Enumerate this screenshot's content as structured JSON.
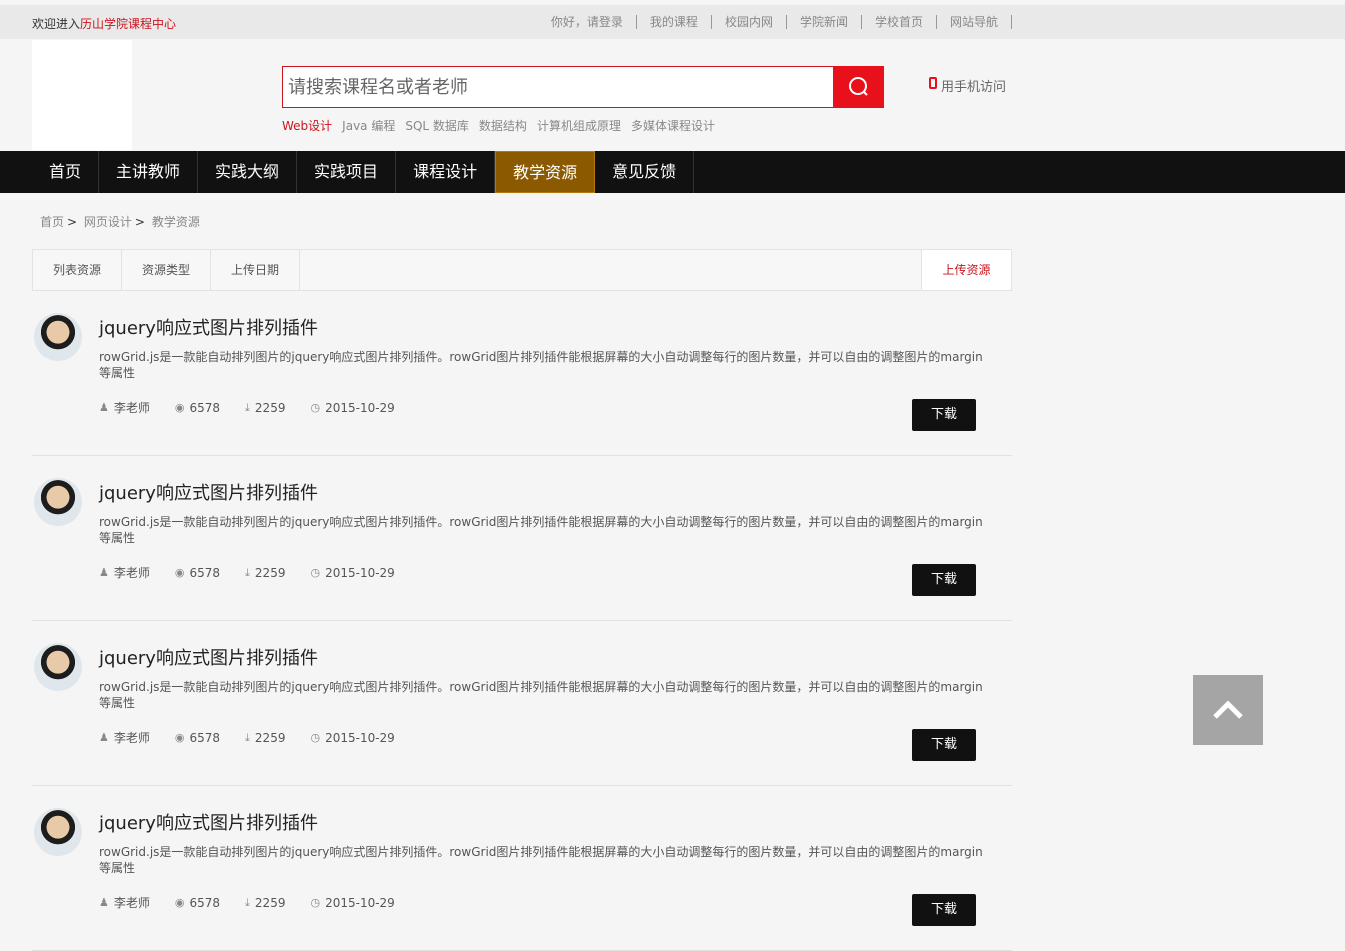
{
  "topbar": {
    "welcome_prefix": "欢迎进入",
    "welcome_highlight": "历山学院课程中心",
    "links": [
      "你好，请登录",
      "我的课程",
      "校园内网",
      "学院新闻",
      "学校首页",
      "网站导航"
    ]
  },
  "search": {
    "placeholder": "请搜索课程名或者老师",
    "hotwords": [
      "Web设计",
      "Java 编程",
      "SQL 数据库",
      "数据结构",
      "计算机组成原理",
      "多媒体课程设计"
    ]
  },
  "mobile_label": "用手机访问",
  "nav": [
    "首页",
    "主讲教师",
    "实践大纲",
    "实践项目",
    "课程设计",
    "教学资源",
    "意见反馈"
  ],
  "breadcrumb": [
    "首页",
    "网页设计",
    "教学资源"
  ],
  "tabs": [
    "列表资源",
    "资源类型",
    "上传日期"
  ],
  "upload_label": "上传资源",
  "resources": [
    {
      "title": "jquery响应式图片排列插件",
      "desc": "rowGrid.js是一款能自动排列图片的jquery响应式图片排列插件。rowGrid图片排列插件能根据屏幕的大小自动调整每行的图片数量，并可以自由的调整图片的margin等属性",
      "author": "李老师",
      "views": "6578",
      "downloads": "2259",
      "date": "2015-10-29",
      "button": "下载"
    },
    {
      "title": "jquery响应式图片排列插件",
      "desc": "rowGrid.js是一款能自动排列图片的jquery响应式图片排列插件。rowGrid图片排列插件能根据屏幕的大小自动调整每行的图片数量，并可以自由的调整图片的margin等属性",
      "author": "李老师",
      "views": "6578",
      "downloads": "2259",
      "date": "2015-10-29",
      "button": "下载"
    },
    {
      "title": "jquery响应式图片排列插件",
      "desc": "rowGrid.js是一款能自动排列图片的jquery响应式图片排列插件。rowGrid图片排列插件能根据屏幕的大小自动调整每行的图片数量，并可以自由的调整图片的margin等属性",
      "author": "李老师",
      "views": "6578",
      "downloads": "2259",
      "date": "2015-10-29",
      "button": "下载"
    },
    {
      "title": "jquery响应式图片排列插件",
      "desc": "rowGrid.js是一款能自动排列图片的jquery响应式图片排列插件。rowGrid图片排列插件能根据屏幕的大小自动调整每行的图片数量，并可以自由的调整图片的margin等属性",
      "author": "李老师",
      "views": "6578",
      "downloads": "2259",
      "date": "2015-10-29",
      "button": "下载"
    }
  ]
}
